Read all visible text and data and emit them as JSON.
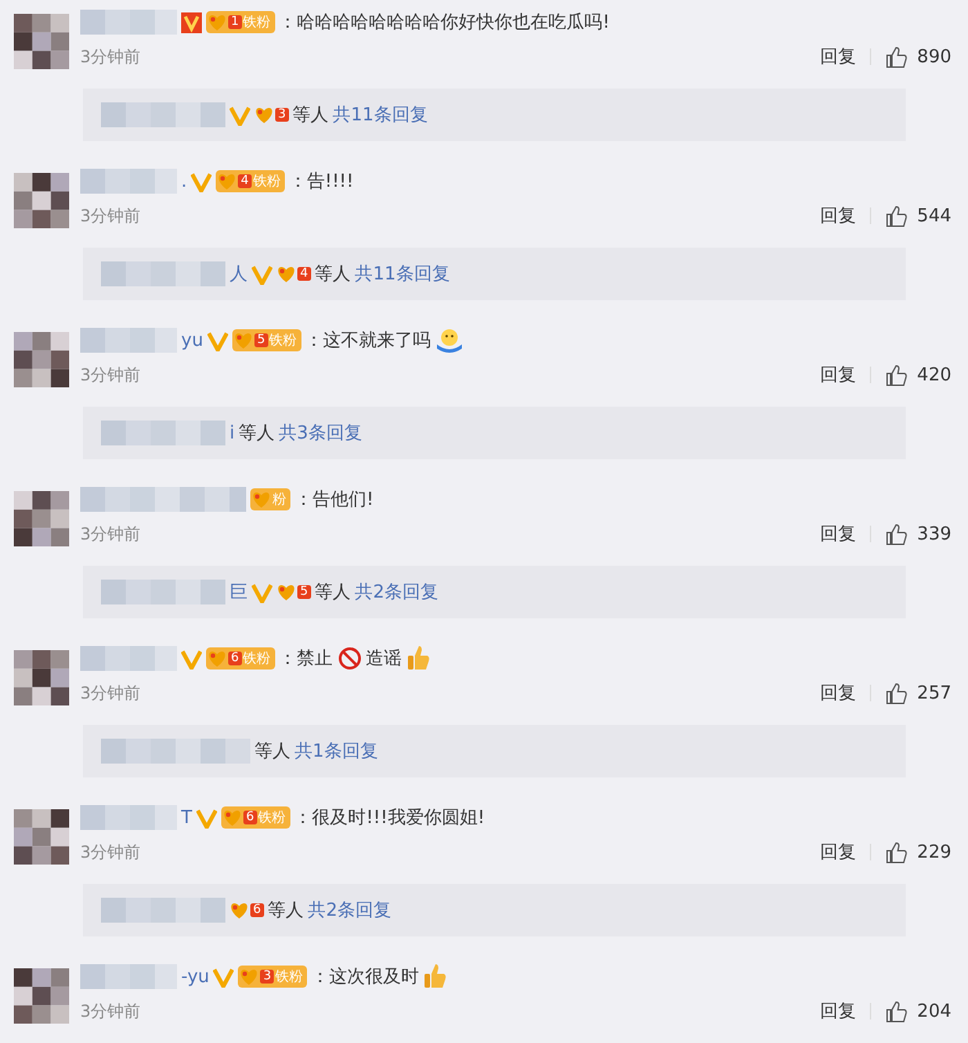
{
  "comments": [
    {
      "verified": {
        "kind": "red"
      },
      "fan_badge": {
        "level": "1",
        "label": "铁粉"
      },
      "content": [
        {
          "kind": "text",
          "text": "：哈哈哈哈哈哈哈哈你好快你也在吃瓜吗!"
        }
      ],
      "time": "3分钟前",
      "reply_action": "回复",
      "likes": "890",
      "replies": {
        "verified": {
          "kind": "gold"
        },
        "badge_level": "3",
        "suffix": "等人",
        "count_link": "共11条回复"
      }
    },
    {
      "name_fragment": ".",
      "verified": {
        "kind": "gold"
      },
      "fan_badge": {
        "level": "4",
        "label": "铁粉"
      },
      "content": [
        {
          "kind": "text",
          "text": "：告!!!!"
        }
      ],
      "time": "3分钟前",
      "reply_action": "回复",
      "likes": "544",
      "replies": {
        "name_fragment": "人",
        "verified": {
          "kind": "gold"
        },
        "badge_level": "4",
        "suffix": "等人",
        "count_link": "共11条回复"
      }
    },
    {
      "name_fragment": "yu",
      "verified": {
        "kind": "gold"
      },
      "fan_badge": {
        "level": "5",
        "label": "铁粉"
      },
      "content": [
        {
          "kind": "text",
          "text": "：这不就来了吗"
        },
        {
          "kind": "hug"
        }
      ],
      "time": "3分钟前",
      "reply_action": "回复",
      "likes": "420",
      "replies": {
        "name_fragment": "i",
        "suffix": "等人",
        "count_link": "共3条回复"
      }
    },
    {
      "fan_badge": {
        "label": "粉"
      },
      "content": [
        {
          "kind": "text",
          "text": "：告他们!"
        }
      ],
      "time": "3分钟前",
      "reply_action": "回复",
      "likes": "339",
      "replies": {
        "name_fragment": "巨",
        "verified": {
          "kind": "gold"
        },
        "badge_level": "5",
        "suffix": "等人",
        "count_link": "共2条回复"
      }
    },
    {
      "verified": {
        "kind": "gold"
      },
      "fan_badge": {
        "level": "6",
        "label": "铁粉"
      },
      "content": [
        {
          "kind": "text",
          "text": "：禁止"
        },
        {
          "kind": "prohibited"
        },
        {
          "kind": "text",
          "text": " 造谣"
        },
        {
          "kind": "thumbs_up"
        }
      ],
      "time": "3分钟前",
      "reply_action": "回复",
      "likes": "257",
      "replies": {
        "suffix": "等人",
        "count_link": "共1条回复"
      }
    },
    {
      "name_fragment": "T",
      "verified": {
        "kind": "gold"
      },
      "fan_badge": {
        "level": "6",
        "label": "铁粉"
      },
      "content": [
        {
          "kind": "text",
          "text": "：很及时!!!我爱你圆姐!"
        }
      ],
      "time": "3分钟前",
      "reply_action": "回复",
      "likes": "229",
      "replies": {
        "badge_level": "6",
        "suffix": "等人",
        "count_link": "共2条回复"
      }
    },
    {
      "name_fragment": "-yu",
      "verified": {
        "kind": "gold"
      },
      "fan_badge": {
        "level": "3",
        "label": "铁粉"
      },
      "content": [
        {
          "kind": "text",
          "text": "：这次很及时"
        },
        {
          "kind": "thumbs_up"
        }
      ],
      "time": "3分钟前",
      "reply_action": "回复",
      "likes": "204"
    }
  ]
}
